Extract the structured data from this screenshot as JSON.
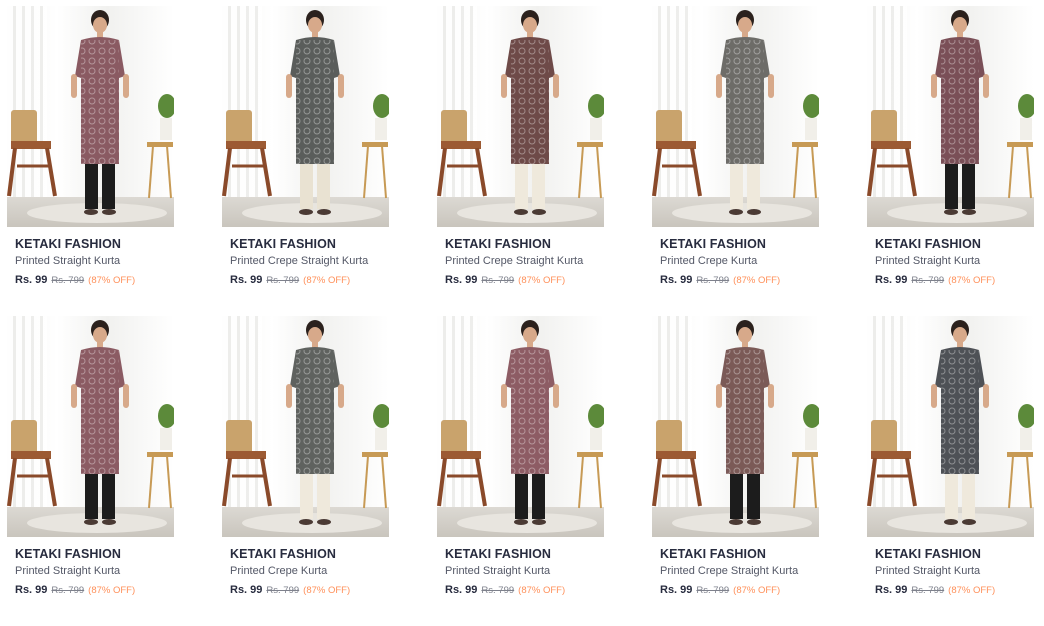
{
  "products": [
    {
      "brand": "KETAKI FASHION",
      "title": "Printed Straight Kurta",
      "price": "Rs. 99",
      "mrp": "Rs. 799",
      "discount": "(87% OFF)",
      "kurta_color": "#8a5a62",
      "pant_color": "#1c1c1c"
    },
    {
      "brand": "KETAKI FASHION",
      "title": "Printed Crepe Straight Kurta",
      "price": "Rs. 99",
      "mrp": "Rs. 799",
      "discount": "(87% OFF)",
      "kurta_color": "#5a5d5b",
      "pant_color": "#e9e2d2"
    },
    {
      "brand": "KETAKI FASHION",
      "title": "Printed Crepe Straight Kurta",
      "price": "Rs. 99",
      "mrp": "Rs. 799",
      "discount": "(87% OFF)",
      "kurta_color": "#6e4a48",
      "pant_color": "#efe9dc"
    },
    {
      "brand": "KETAKI FASHION",
      "title": "Printed Crepe Kurta",
      "price": "Rs. 99",
      "mrp": "Rs. 799",
      "discount": "(87% OFF)",
      "kurta_color": "#6d6c68",
      "pant_color": "#efe9dc"
    },
    {
      "brand": "KETAKI FASHION",
      "title": "Printed Straight Kurta",
      "price": "Rs. 99",
      "mrp": "Rs. 799",
      "discount": "(87% OFF)",
      "kurta_color": "#7a4f57",
      "pant_color": "#1c1c1c"
    },
    {
      "brand": "KETAKI FASHION",
      "title": "Printed Straight Kurta",
      "price": "Rs. 99",
      "mrp": "Rs. 799",
      "discount": "(87% OFF)",
      "kurta_color": "#8b5b63",
      "pant_color": "#1c1c1c"
    },
    {
      "brand": "KETAKI FASHION",
      "title": "Printed Crepe Kurta",
      "price": "Rs. 99",
      "mrp": "Rs. 799",
      "discount": "(87% OFF)",
      "kurta_color": "#5f625f",
      "pant_color": "#efe9dc"
    },
    {
      "brand": "KETAKI FASHION",
      "title": "Printed Straight Kurta",
      "price": "Rs. 99",
      "mrp": "Rs. 799",
      "discount": "(87% OFF)",
      "kurta_color": "#8d5c64",
      "pant_color": "#1c1c1c"
    },
    {
      "brand": "KETAKI FASHION",
      "title": "Printed Crepe Straight Kurta",
      "price": "Rs. 99",
      "mrp": "Rs. 799",
      "discount": "(87% OFF)",
      "kurta_color": "#7b5a57",
      "pant_color": "#1c1c1c"
    },
    {
      "brand": "KETAKI FASHION",
      "title": "Printed Straight Kurta",
      "price": "Rs. 99",
      "mrp": "Rs. 799",
      "discount": "(87% OFF)",
      "kurta_color": "#4e5156",
      "pant_color": "#efe9dc"
    }
  ],
  "colors": {
    "brand_text": "#282c3f",
    "discount": "#ff905a",
    "mrp": "#7e818c"
  }
}
